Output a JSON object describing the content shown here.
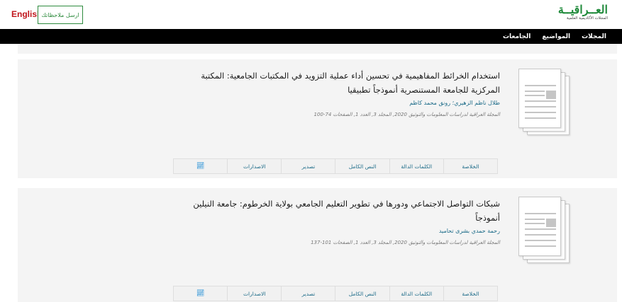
{
  "header": {
    "english_label": "English",
    "feedback_label": "ارسل ملاحظاتك",
    "logo_title": "العــراقيــة",
    "logo_subtitle": "المجلات الأكاديمية العلمية"
  },
  "nav": {
    "items": [
      "المجلات",
      "المواضيع",
      "الجامعات"
    ]
  },
  "articles": [
    {
      "title": "استخدام الخرائط المفاهيمية في تحسين أداء عملية التزويد في المكتبات الجامعية: المكتبة المركزية للجامعة المستنصرية أنموذجاً تطبيقيا",
      "authors": "طلال ناظم الزهيري؛ رونق محمد كاظم",
      "source": "المجلة العراقية لدراسات المعلومات والتوثيق 2020, المجلد 3, العدد 1, الصفحات 74-100",
      "tabs": [
        "الخلاصة",
        "الكلمات الدالة",
        "النص الكامل",
        "تصدير",
        "الاصدارات"
      ],
      "stats_icon": "stats-chart-icon"
    },
    {
      "title": "شبكات التواصل الاجتماعي ودورها في تطوير التعليم الجامعي بولاية الخرطوم: جامعة النيلين أنموذجاً",
      "authors": "رحمة حمدي بشرى تحاميد",
      "source": "المجلة العراقية لدراسات المعلومات والتوثيق 2020, المجلد 3, العدد 1, الصفحات 101-137",
      "tabs": [
        "الخلاصة",
        "الكلمات الدالة",
        "النص الكامل",
        "تصدير",
        "الاصدارات"
      ],
      "stats_icon": "stats-chart-icon"
    }
  ],
  "colors": {
    "brand_green": "#1f8a3a",
    "english_red": "#c0161c",
    "navbar_bg": "#000000",
    "link_blue": "#1f6d8a"
  }
}
